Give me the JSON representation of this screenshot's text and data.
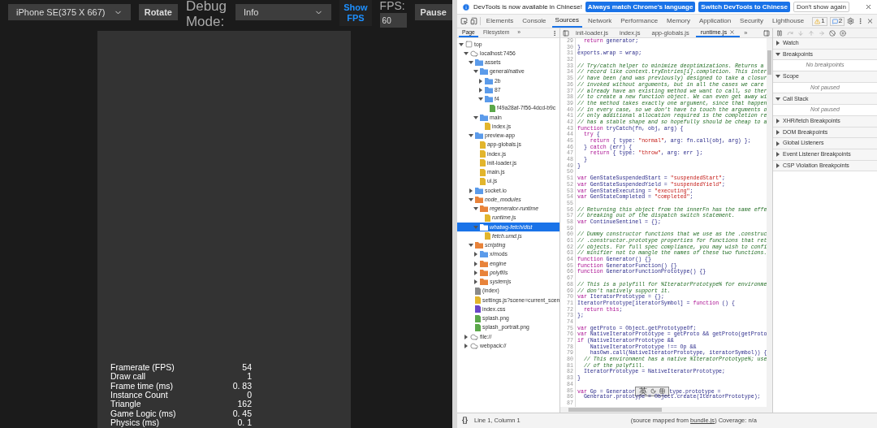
{
  "simulator": {
    "device": "iPhone SE(375 X 667)",
    "rotate": "Rotate",
    "debug_label": "Debug Mode:",
    "debug_mode": "Info",
    "show_fps": {
      "label": "Show FPS",
      "on": true
    },
    "fps_label": "FPS:",
    "fps_value": "60",
    "pause": "Pause",
    "stats": [
      {
        "label": "Framerate (FPS)",
        "value": "54"
      },
      {
        "label": "Draw call",
        "value": "1"
      },
      {
        "label": "Frame time (ms)",
        "value": "0. 83"
      },
      {
        "label": "Instance Count",
        "value": "0"
      },
      {
        "label": "Triangle",
        "value": "162"
      },
      {
        "label": "Game Logic (ms)",
        "value": "0. 45"
      },
      {
        "label": "Physics (ms)",
        "value": "0. 1"
      }
    ]
  },
  "infobar": {
    "message": "DevTools is now available in Chinese!",
    "buttons": [
      {
        "label": "Always match Chrome's language",
        "kind": "primary"
      },
      {
        "label": "Switch DevTools to Chinese",
        "kind": "primary"
      },
      {
        "label": "Don't show again",
        "kind": "plain"
      }
    ]
  },
  "tabs": [
    {
      "label": "Elements",
      "selected": false
    },
    {
      "label": "Console",
      "selected": false
    },
    {
      "label": "Sources",
      "selected": true
    },
    {
      "label": "Network",
      "selected": false
    },
    {
      "label": "Performance",
      "selected": false
    },
    {
      "label": "Memory",
      "selected": false
    },
    {
      "label": "Application",
      "selected": false
    },
    {
      "label": "Security",
      "selected": false
    },
    {
      "label": "Lighthouse",
      "selected": false
    }
  ],
  "warnings": "1",
  "messages": "2",
  "navigator_tabs": [
    {
      "label": "Page",
      "selected": true
    },
    {
      "label": "Filesystem",
      "selected": false
    }
  ],
  "navigator_more": "»",
  "editor_tabs": [
    {
      "label": "init-loader.js",
      "selected": false
    },
    {
      "label": "index.js",
      "selected": false
    },
    {
      "label": "app-globals.js",
      "selected": false
    },
    {
      "label": "runtime.js",
      "selected": true
    }
  ],
  "editor_more": "»",
  "tree": [
    {
      "label": "top",
      "kind": "frame",
      "expanded": true,
      "selected": false,
      "italic": false,
      "children": [
        {
          "label": "localhost:7456",
          "kind": "cloud",
          "expanded": true,
          "selected": false,
          "italic": false,
          "children": [
            {
              "label": "assets",
              "kind": "folder",
              "color": "#5b9bea",
              "expanded": true,
              "selected": false,
              "italic": false,
              "children": [
                {
                  "label": "general/native",
                  "kind": "folder",
                  "color": "#5b9bea",
                  "expanded": true,
                  "selected": false,
                  "italic": false,
                  "children": [
                    {
                      "label": "2b",
                      "kind": "folder",
                      "color": "#5b9bea",
                      "expanded": false,
                      "selected": false,
                      "italic": false
                    },
                    {
                      "label": "87",
                      "kind": "folder",
                      "color": "#5b9bea",
                      "expanded": false,
                      "selected": false,
                      "italic": false
                    },
                    {
                      "label": "f4",
                      "kind": "folder",
                      "color": "#5b9bea",
                      "expanded": true,
                      "selected": false,
                      "italic": false,
                      "children": [
                        {
                          "label": "f49a28af-7f56-4dcd-b9c",
                          "kind": "file",
                          "color": "#5ba84a",
                          "selected": false,
                          "italic": false
                        }
                      ]
                    }
                  ]
                },
                {
                  "label": "main",
                  "kind": "folder",
                  "color": "#5b9bea",
                  "expanded": true,
                  "selected": false,
                  "italic": false,
                  "children": [
                    {
                      "label": "index.js",
                      "kind": "file",
                      "color": "#e2b52c",
                      "selected": false,
                      "italic": false
                    }
                  ]
                }
              ]
            },
            {
              "label": "preview-app",
              "kind": "folder",
              "color": "#5b9bea",
              "expanded": true,
              "selected": false,
              "italic": false,
              "children": [
                {
                  "label": "app-globals.js",
                  "kind": "file",
                  "color": "#e2b52c",
                  "selected": false,
                  "italic": false
                },
                {
                  "label": "index.js",
                  "kind": "file",
                  "color": "#e2b52c",
                  "selected": false,
                  "italic": false
                },
                {
                  "label": "init-loader.js",
                  "kind": "file",
                  "color": "#e2b52c",
                  "selected": false,
                  "italic": false
                },
                {
                  "label": "main.js",
                  "kind": "file",
                  "color": "#e2b52c",
                  "selected": false,
                  "italic": false
                },
                {
                  "label": "ui.js",
                  "kind": "file",
                  "color": "#e2b52c",
                  "selected": false,
                  "italic": false
                }
              ]
            },
            {
              "label": "socket.io",
              "kind": "folder",
              "color": "#5b9bea",
              "expanded": false,
              "selected": false,
              "italic": false
            },
            {
              "label": "node_modules",
              "kind": "folder",
              "color": "#e8833a",
              "expanded": true,
              "selected": false,
              "italic": true,
              "children": [
                {
                  "label": "regenerator-runtime",
                  "kind": "folder",
                  "color": "#e8833a",
                  "expanded": true,
                  "selected": false,
                  "italic": true,
                  "children": [
                    {
                      "label": "runtime.js",
                      "kind": "file",
                      "color": "#e2b52c",
                      "selected": false,
                      "italic": true
                    }
                  ]
                },
                {
                  "label": "whatwg-fetch/dist",
                  "kind": "folder",
                  "expanded": true,
                  "selected": true,
                  "italic": true,
                  "children": [
                    {
                      "label": "fetch.umd.js",
                      "kind": "file",
                      "color": "#e2b52c",
                      "selected": false,
                      "italic": true
                    }
                  ]
                }
              ]
            },
            {
              "label": "scripting",
              "kind": "folder",
              "color": "#e8833a",
              "expanded": true,
              "selected": false,
              "italic": true,
              "children": [
                {
                  "label": "x/mods",
                  "kind": "folder",
                  "color": "#5b9bea",
                  "expanded": false,
                  "selected": false,
                  "italic": false
                },
                {
                  "label": "engine",
                  "kind": "folder",
                  "color": "#e8833a",
                  "expanded": false,
                  "selected": false,
                  "italic": true
                },
                {
                  "label": "polyfills",
                  "kind": "folder",
                  "color": "#e8833a",
                  "expanded": false,
                  "selected": false,
                  "italic": true
                },
                {
                  "label": "systemjs",
                  "kind": "folder",
                  "color": "#e8833a",
                  "expanded": false,
                  "selected": false,
                  "italic": true
                }
              ]
            },
            {
              "label": "(index)",
              "kind": "file",
              "color": "#8a8a8a",
              "selected": false,
              "italic": false
            },
            {
              "label": "settings.js?scene=current_scen",
              "kind": "file",
              "color": "#e2b52c",
              "selected": false,
              "italic": false
            },
            {
              "label": "index.css",
              "kind": "file",
              "color": "#6a46c8",
              "selected": false,
              "italic": false
            },
            {
              "label": "splash.png",
              "kind": "file",
              "color": "#5ba84a",
              "selected": false,
              "italic": false
            },
            {
              "label": "splash_portrait.png",
              "kind": "file",
              "color": "#5ba84a",
              "selected": false,
              "italic": false
            }
          ]
        },
        {
          "label": "file://",
          "kind": "cloud",
          "expanded": false,
          "selected": false,
          "italic": false
        },
        {
          "label": "webpack://",
          "kind": "cloud",
          "expanded": false,
          "selected": false,
          "italic": false
        }
      ]
    }
  ],
  "ime_bar": {
    "label": "英"
  },
  "code": [
    {
      "n": "29",
      "parts": [
        {
          "kind": "kw",
          "text": "  return"
        },
        {
          "kind": "plain",
          "text": " generator;"
        }
      ]
    },
    {
      "n": "30",
      "parts": [
        {
          "kind": "plain",
          "text": "}"
        }
      ]
    },
    {
      "n": "31",
      "parts": [
        {
          "kind": "plain",
          "text": "exports.wrap = wrap;"
        }
      ]
    },
    {
      "n": "32"
    },
    {
      "n": "33",
      "parts": [
        {
          "kind": "comment",
          "text": "// Try/catch helper to minimize deoptimizations. Returns a"
        }
      ]
    },
    {
      "n": "34",
      "parts": [
        {
          "kind": "comment",
          "text": "// record like context.tryEntries[i].completion. This inter"
        }
      ]
    },
    {
      "n": "35",
      "parts": [
        {
          "kind": "comment",
          "text": "// have been (and was previously) designed to take a closur"
        }
      ]
    },
    {
      "n": "36",
      "parts": [
        {
          "kind": "comment",
          "text": "// invoked without arguments, but in all the cases we care"
        }
      ]
    },
    {
      "n": "37",
      "parts": [
        {
          "kind": "comment",
          "text": "// already have an existing method we want to call, so ther"
        }
      ]
    },
    {
      "n": "38",
      "parts": [
        {
          "kind": "comment",
          "text": "// to create a new function object. We can even get away wi"
        }
      ]
    },
    {
      "n": "39",
      "parts": [
        {
          "kind": "comment",
          "text": "// the method takes exactly one argument, since that happen"
        }
      ]
    },
    {
      "n": "40",
      "parts": [
        {
          "kind": "comment",
          "text": "// in every case, so we don't have to touch the arguments o"
        }
      ]
    },
    {
      "n": "41",
      "parts": [
        {
          "kind": "comment",
          "text": "// only additional allocation required is the completion re"
        }
      ]
    },
    {
      "n": "42",
      "parts": [
        {
          "kind": "comment",
          "text": "// has a stable shape and so hopefully should be cheap to a"
        }
      ]
    },
    {
      "n": "43",
      "parts": [
        {
          "kind": "kw",
          "text": "function"
        },
        {
          "kind": "plain",
          "text": " tryCatch(fn, obj, arg) {"
        }
      ]
    },
    {
      "n": "44",
      "parts": [
        {
          "kind": "kw",
          "text": "  try"
        },
        {
          "kind": "plain",
          "text": " {"
        }
      ]
    },
    {
      "n": "45",
      "parts": [
        {
          "kind": "kw",
          "text": "    return"
        },
        {
          "kind": "plain",
          "text": " { type: "
        },
        {
          "kind": "str",
          "text": "\"normal\""
        },
        {
          "kind": "plain",
          "text": ", arg: fn.call(obj, arg) };"
        }
      ]
    },
    {
      "n": "46",
      "parts": [
        {
          "kind": "plain",
          "text": "  } "
        },
        {
          "kind": "kw",
          "text": "catch"
        },
        {
          "kind": "plain",
          "text": " (err) {"
        }
      ]
    },
    {
      "n": "47",
      "parts": [
        {
          "kind": "kw",
          "text": "    return"
        },
        {
          "kind": "plain",
          "text": " { type: "
        },
        {
          "kind": "str",
          "text": "\"throw\""
        },
        {
          "kind": "plain",
          "text": ", arg: err };"
        }
      ]
    },
    {
      "n": "48",
      "parts": [
        {
          "kind": "plain",
          "text": "  }"
        }
      ]
    },
    {
      "n": "49",
      "parts": [
        {
          "kind": "plain",
          "text": "}"
        }
      ]
    },
    {
      "n": "50"
    },
    {
      "n": "51",
      "parts": [
        {
          "kind": "kw",
          "text": "var"
        },
        {
          "kind": "plain",
          "text": " GenStateSuspendedStart = "
        },
        {
          "kind": "str",
          "text": "\"suspendedStart\""
        },
        {
          "kind": "plain",
          "text": ";"
        }
      ]
    },
    {
      "n": "52",
      "parts": [
        {
          "kind": "kw",
          "text": "var"
        },
        {
          "kind": "plain",
          "text": " GenStateSuspendedYield = "
        },
        {
          "kind": "str",
          "text": "\"suspendedYield\""
        },
        {
          "kind": "plain",
          "text": ";"
        }
      ]
    },
    {
      "n": "53",
      "parts": [
        {
          "kind": "kw",
          "text": "var"
        },
        {
          "kind": "plain",
          "text": " GenStateExecuting = "
        },
        {
          "kind": "str",
          "text": "\"executing\""
        },
        {
          "kind": "plain",
          "text": ";"
        }
      ]
    },
    {
      "n": "54",
      "parts": [
        {
          "kind": "kw",
          "text": "var"
        },
        {
          "kind": "plain",
          "text": " GenStateCompleted = "
        },
        {
          "kind": "str",
          "text": "\"completed\""
        },
        {
          "kind": "plain",
          "text": ";"
        }
      ]
    },
    {
      "n": "55"
    },
    {
      "n": "56",
      "parts": [
        {
          "kind": "comment",
          "text": "// Returning this object from the innerFn has the same effe"
        }
      ]
    },
    {
      "n": "57",
      "parts": [
        {
          "kind": "comment",
          "text": "// breaking out of the dispatch switch statement."
        }
      ]
    },
    {
      "n": "58",
      "parts": [
        {
          "kind": "kw",
          "text": "var"
        },
        {
          "kind": "plain",
          "text": " ContinueSentinel = {};"
        }
      ]
    },
    {
      "n": "59"
    },
    {
      "n": "60",
      "parts": [
        {
          "kind": "comment",
          "text": "// Dummy constructor functions that we use as the .construc"
        }
      ]
    },
    {
      "n": "61",
      "parts": [
        {
          "kind": "comment",
          "text": "// .constructor.prototype properties for functions that ret"
        }
      ]
    },
    {
      "n": "62",
      "parts": [
        {
          "kind": "comment",
          "text": "// objects. For full spec compliance, you may wish to confi"
        }
      ]
    },
    {
      "n": "63",
      "parts": [
        {
          "kind": "comment",
          "text": "// minifier not to mangle the names of these two functions."
        }
      ]
    },
    {
      "n": "64",
      "parts": [
        {
          "kind": "kw",
          "text": "function"
        },
        {
          "kind": "plain",
          "text": " Generator() {}"
        }
      ]
    },
    {
      "n": "65",
      "parts": [
        {
          "kind": "kw",
          "text": "function"
        },
        {
          "kind": "plain",
          "text": " GeneratorFunction() {}"
        }
      ]
    },
    {
      "n": "66",
      "parts": [
        {
          "kind": "kw",
          "text": "function"
        },
        {
          "kind": "plain",
          "text": " GeneratorFunctionPrototype() {}"
        }
      ]
    },
    {
      "n": "67"
    },
    {
      "n": "68",
      "parts": [
        {
          "kind": "comment",
          "text": "// This is a polyfill for %IteratorPrototype% for environme"
        }
      ]
    },
    {
      "n": "69",
      "parts": [
        {
          "kind": "comment",
          "text": "// don't natively support it."
        }
      ]
    },
    {
      "n": "70",
      "parts": [
        {
          "kind": "kw",
          "text": "var"
        },
        {
          "kind": "plain",
          "text": " IteratorPrototype = {};"
        }
      ]
    },
    {
      "n": "71",
      "parts": [
        {
          "kind": "plain",
          "text": "IteratorPrototype[iteratorSymbol] = "
        },
        {
          "kind": "kw",
          "text": "function"
        },
        {
          "kind": "plain",
          "text": " () {"
        }
      ]
    },
    {
      "n": "72",
      "parts": [
        {
          "kind": "kw",
          "text": "  return this"
        },
        {
          "kind": "plain",
          "text": ";"
        }
      ]
    },
    {
      "n": "73",
      "parts": [
        {
          "kind": "plain",
          "text": "};"
        }
      ]
    },
    {
      "n": "74"
    },
    {
      "n": "75",
      "parts": [
        {
          "kind": "kw",
          "text": "var"
        },
        {
          "kind": "plain",
          "text": " getProto = Object.getPrototypeOf;"
        }
      ]
    },
    {
      "n": "76",
      "parts": [
        {
          "kind": "kw",
          "text": "var"
        },
        {
          "kind": "plain",
          "text": " NativeIteratorPrototype = getProto && getProto(getProto"
        }
      ]
    },
    {
      "n": "77",
      "parts": [
        {
          "kind": "kw",
          "text": "if"
        },
        {
          "kind": "plain",
          "text": " (NativeIteratorPrototype &&"
        }
      ]
    },
    {
      "n": "78",
      "parts": [
        {
          "kind": "plain",
          "text": "    NativeIteratorPrototype !== Op &&"
        }
      ]
    },
    {
      "n": "79",
      "parts": [
        {
          "kind": "plain",
          "text": "    hasOwn.call(NativeIteratorPrototype, iteratorSymbol)) {"
        }
      ]
    },
    {
      "n": "80",
      "parts": [
        {
          "kind": "comment",
          "text": "  // This environment has a native %IteratorPrototype%; use"
        }
      ]
    },
    {
      "n": "81",
      "parts": [
        {
          "kind": "comment",
          "text": "  // of the polyfill."
        }
      ]
    },
    {
      "n": "82",
      "parts": [
        {
          "kind": "plain",
          "text": "  IteratorPrototype = NativeIteratorPrototype;"
        }
      ]
    },
    {
      "n": "83",
      "parts": [
        {
          "kind": "plain",
          "text": "}"
        }
      ]
    },
    {
      "n": "84"
    },
    {
      "n": "85",
      "parts": [
        {
          "kind": "kw",
          "text": "var"
        },
        {
          "kind": "plain",
          "text": " Gp = Generator"
        },
        {
          "kind": "ime"
        },
        {
          "kind": "plain",
          "text": "type.prototype ="
        }
      ]
    },
    {
      "n": "86",
      "parts": [
        {
          "kind": "plain",
          "text": "  Generator.prototype = Object.create(IteratorPrototype);"
        }
      ]
    },
    {
      "n": "87"
    }
  ],
  "status_bar": {
    "pretty_print": "{}",
    "position": "Line 1, Column 1",
    "source_prefix": "(source mapped from",
    "source_link": "bundle.js",
    "source_suffix": ") Coverage: n/a"
  },
  "sidebar": [
    {
      "label": "Watch",
      "expanded": false
    },
    {
      "label": "Breakpoints",
      "expanded": true,
      "empty_text": "No breakpoints"
    },
    {
      "label": "Scope",
      "expanded": true,
      "empty_text": "Not paused"
    },
    {
      "label": "Call Stack",
      "expanded": true,
      "empty_text": "Not paused"
    },
    {
      "label": "XHR/fetch Breakpoints",
      "expanded": false
    },
    {
      "label": "DOM Breakpoints",
      "expanded": false
    },
    {
      "label": "Global Listeners",
      "expanded": false
    },
    {
      "label": "Event Listener Breakpoints",
      "expanded": false
    },
    {
      "label": "CSP Violation Breakpoints",
      "expanded": false
    }
  ]
}
